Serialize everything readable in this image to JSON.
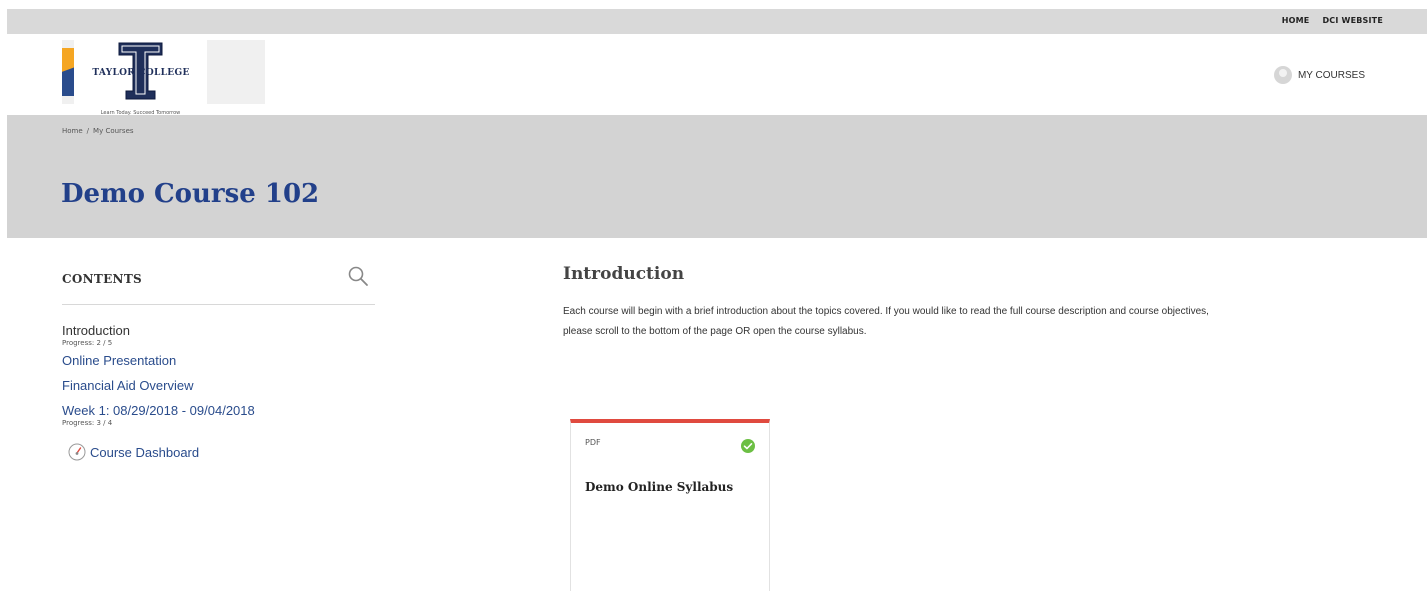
{
  "topbar": {
    "home": "HOME",
    "dci_website": "DCI WEBSITE"
  },
  "logo": {
    "name": "TAYLOR COLLEGE",
    "tagline": "Learn Today. Succeed Tomorrow"
  },
  "header": {
    "my_courses": "MY COURSES"
  },
  "breadcrumb": {
    "home": "Home",
    "separator": "/",
    "current": "My Courses"
  },
  "page_title": "Demo Course 102",
  "sidebar": {
    "title": "CONTENTS",
    "items": [
      {
        "label": "Introduction",
        "progress": "Progress: 2 / 5"
      },
      {
        "label": "Online Presentation"
      },
      {
        "label": "Financial Aid Overview"
      },
      {
        "label": "Week 1: 08/29/2018 - 09/04/2018",
        "progress": "Progress: 3 / 4"
      }
    ],
    "dashboard": "Course Dashboard"
  },
  "main": {
    "title": "Introduction",
    "description": "Each course will begin with a brief introduction about the topics covered. If you would like to read the full course description and course objectives, please scroll to the bottom of the page OR open the course syllabus."
  },
  "card": {
    "type": "PDF",
    "title": "Demo Online Syllabus",
    "completed": true
  },
  "colors": {
    "title_blue": "#22408a",
    "accent_red": "#e04a3f",
    "check_green": "#6cbf44",
    "banner_gray": "#d3d3d3"
  }
}
